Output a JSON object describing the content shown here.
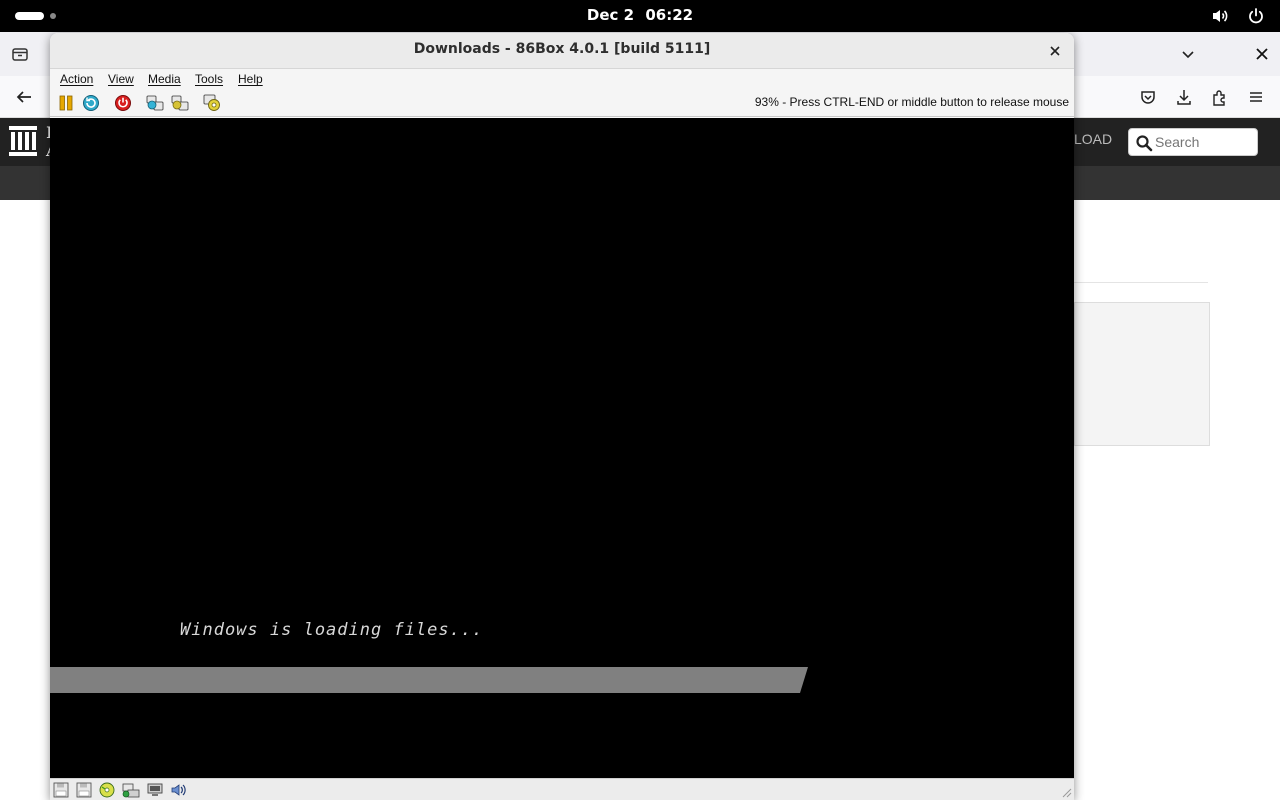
{
  "topbar": {
    "date": "Dec 2",
    "time": "06:22",
    "icons": [
      "volume-icon",
      "power-icon"
    ]
  },
  "browser": {
    "site_logo_text_line1": "I",
    "site_logo_text_line2": "A",
    "upload_label": "LOAD",
    "search_placeholder": "Search"
  },
  "window": {
    "title": "Downloads - 86Box 4.0.1 [build 5111]",
    "menu": {
      "action": "Action",
      "view": "View",
      "media": "Media",
      "tools": "Tools",
      "help": "Help"
    },
    "toolbar_icons": [
      "pause-icon",
      "reset-icon",
      "power-off-icon",
      "ctrl-alt-del-icon",
      "ctrl-alt-esc-icon",
      "settings-icon"
    ],
    "status_message": "93% - Press CTRL-END or middle button to release mouse",
    "emulated_screen": {
      "loading_text": "Windows is loading files...",
      "progress": 0.74
    },
    "statusbar_icons": [
      "floppy-drive-1-icon",
      "floppy-drive-2-icon",
      "cdrom-icon",
      "hard-disk-icon",
      "network-icon",
      "sound-icon"
    ]
  },
  "colors": {
    "topbar_bg": "#000000",
    "screen_bg": "#000000",
    "progress_fill": "#808080",
    "loading_text": "#d8d8d8"
  }
}
